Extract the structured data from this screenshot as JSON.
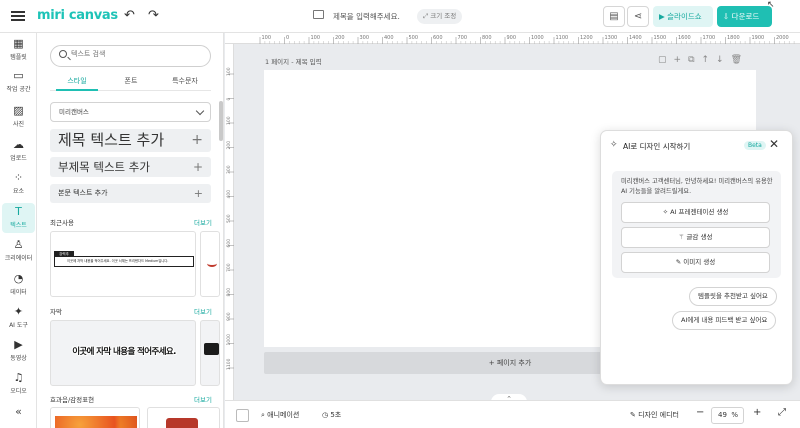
{
  "app": {
    "logo": "miri canvas",
    "document_title": "제목을 입력해주세요.",
    "size_button": "크기 조정"
  },
  "topbar": {
    "slide_label": "슬라이드쇼",
    "download_label": "다운로드"
  },
  "colors": {
    "accent": "#1fbfb3",
    "accent_light": "#dff5f4",
    "canvas_bg": "#e9ebee"
  },
  "rail": [
    {
      "icon": "template-icon",
      "label": "템플릿"
    },
    {
      "icon": "workspace-icon",
      "label": "작업 공간"
    },
    {
      "icon": "photo-icon",
      "label": "사진"
    },
    {
      "icon": "upload-icon",
      "label": "업로드"
    },
    {
      "icon": "elements-icon",
      "label": "요소"
    },
    {
      "icon": "text-icon",
      "label": "텍스트"
    },
    {
      "icon": "creator-icon",
      "label": "크리에이터"
    },
    {
      "icon": "data-icon",
      "label": "데이터"
    },
    {
      "icon": "ai-tool-icon",
      "label": "AI 도구"
    },
    {
      "icon": "video-icon",
      "label": "동영상"
    },
    {
      "icon": "audio-icon",
      "label": "오디오"
    }
  ],
  "panel": {
    "search_placeholder": "텍스트 검색",
    "tabs": [
      "스타일",
      "폰트",
      "특수문자"
    ],
    "font_select": "미리캔버스",
    "add_title": "제목 텍스트 추가",
    "add_subtitle": "부제목 텍스트 추가",
    "add_body": "본문 텍스트 추가",
    "recent_label": "최근사용",
    "more": "더보기",
    "recent_card_tag": "강력추",
    "recent_card_text": "이곳에 자막 내용을 적어주세요. 이곳 서체는 프리텐다드 Medium입니다.",
    "subtitle_label": "자막",
    "subtitle_sample": "이곳에 자막 내용을 적어주세요.",
    "effects_label": "효과음/감정표현"
  },
  "canvas": {
    "page_header": "1 페이지 - 제목 입력",
    "add_page": "페이지 추가",
    "ruler_top": [
      "100",
      "0",
      "100",
      "200",
      "300",
      "400",
      "500",
      "600",
      "700",
      "800",
      "900",
      "1000",
      "1100",
      "1200",
      "1300",
      "1400",
      "1500",
      "1600",
      "1700",
      "1800",
      "1900",
      "2000"
    ],
    "ruler_left": [
      "100",
      "0",
      "100",
      "200",
      "300",
      "400",
      "500",
      "600",
      "700",
      "800",
      "900",
      "1000",
      "1100"
    ]
  },
  "bottombar": {
    "animation": "애니메이션",
    "duration": "5초",
    "design_editor": "디자인 에디터",
    "zoom": "49",
    "zoom_unit": "%"
  },
  "ai_panel": {
    "title": "AI로 디자인 시작하기",
    "badge": "Beta",
    "message": "미리캔버스 고객센터님, 안녕하세요! 미리캔버스의 유용한 AI 기능들을 알려드릴게요.",
    "buttons": [
      "AI 프레젠테이션 생성",
      "글감 생성",
      "이미지 생성"
    ],
    "chips": [
      "템플릿을 추천받고 싶어요",
      "AI에게 내용 피드백 받고 싶어요"
    ]
  }
}
